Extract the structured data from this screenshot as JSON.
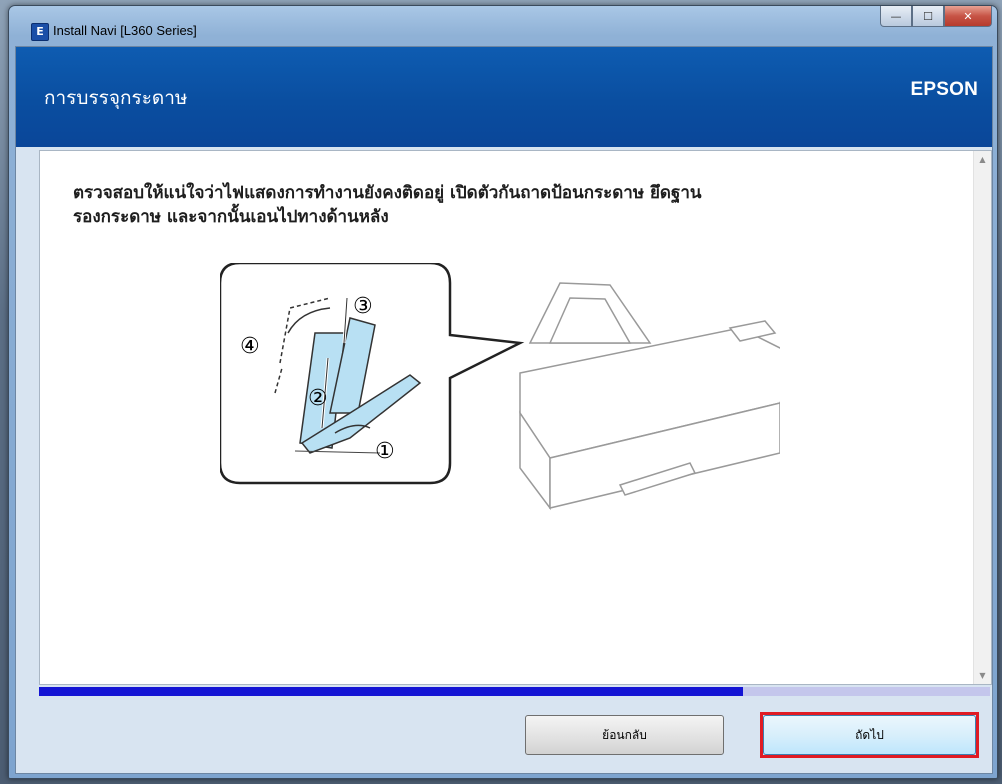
{
  "window": {
    "title": "Install Navi [L360 Series]",
    "app_icon": "E",
    "controls": {
      "minimize": "minimize-icon",
      "maximize": "maximize-icon",
      "close": "close-icon"
    }
  },
  "header": {
    "title": "การบรรจุกระดาษ",
    "brand": "EPSON"
  },
  "content": {
    "instruction_line1": "ตรวจสอบให้แน่ใจว่าไฟแสดงการทำงานยังคงติดอยู่ เปิดตัวกันถาดป้อนกระดาษ ยึดฐาน",
    "instruction_line2": "รองกระดาษ และจากนั้นเอนไปทางด้านหลัง",
    "steps": [
      "①",
      "②",
      "③",
      "④"
    ]
  },
  "progress": {
    "value": 0.74,
    "color": "#1414d4",
    "track_color": "#c4c6ec"
  },
  "buttons": {
    "back_label": "ย้อนกลับ",
    "next_label": "ถัดไป"
  },
  "colors": {
    "header": "#0a4ea0",
    "highlight": "#e01b24"
  }
}
